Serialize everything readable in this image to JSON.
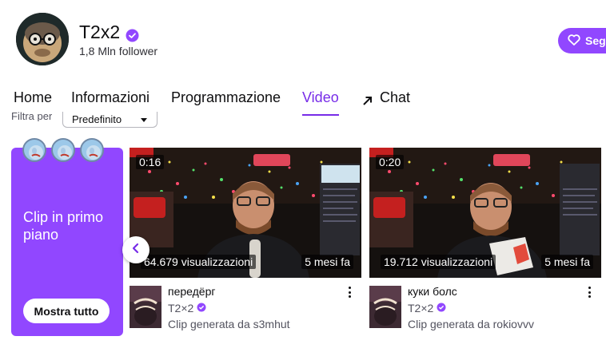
{
  "channel": {
    "name": "T2x2",
    "followers": "1,8 Mln follower",
    "follow_label": "Seg"
  },
  "tabs": [
    {
      "label": "Home"
    },
    {
      "label": "Informazioni"
    },
    {
      "label": "Programmazione"
    },
    {
      "label": "Video",
      "active": true
    },
    {
      "label": "Chat"
    }
  ],
  "filter": {
    "label": "Filtra per",
    "selected": "Predefinito"
  },
  "promo": {
    "title": "Clip in primo piano",
    "button": "Mostra tutto"
  },
  "clips": [
    {
      "duration": "0:16",
      "views": "64.679 visualizzazioni",
      "ago": "5 mesi fa",
      "title": "передёрг",
      "channel": "T2×2",
      "created_by": "Clip generata da s3mhut"
    },
    {
      "duration": "0:20",
      "views": "19.712 visualizzazioni",
      "ago": "5 mesi fa",
      "title": "куки болс",
      "channel": "T2×2",
      "created_by": "Clip generata da rokiovvv"
    }
  ],
  "colors": {
    "accent": "#9147ff",
    "active_tab": "#772ce8"
  },
  "icons": {
    "verified": "verified-badge-icon",
    "heart": "heart-icon",
    "chat": "arrow-up-right-icon",
    "more": "more-vertical-icon",
    "prev": "chevron-left-icon"
  }
}
